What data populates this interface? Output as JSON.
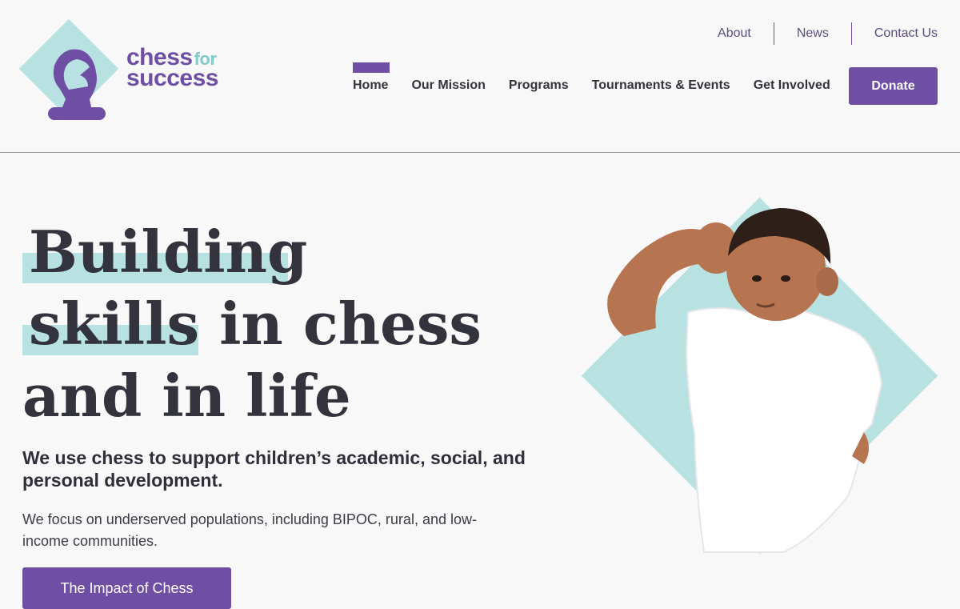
{
  "brand": {
    "logo_line1": "chess",
    "logo_for": "for",
    "logo_line2": "success"
  },
  "top_nav": {
    "items": [
      "About",
      "News",
      "Contact Us"
    ]
  },
  "main_nav": {
    "items": [
      "Home",
      "Our Mission",
      "Programs",
      "Tournaments & Events",
      "Get Involved"
    ],
    "active": "Home"
  },
  "donate_label": "Donate",
  "hero": {
    "line1": "Building",
    "line2_highlight": "skills",
    "line2_rest": " in chess",
    "line3": "and in life",
    "subhead": "We use chess to support children’s academic, social, and personal development.",
    "body": "We focus on underserved populations, including BIPOC, rural, and low-income communities.",
    "cta_label": "The Impact of Chess"
  },
  "colors": {
    "brand_purple": "#6f4fa3",
    "brand_teal": "#b8e2e2",
    "text_dark": "#33333e"
  },
  "icons": {
    "logo": "knight-icon"
  }
}
